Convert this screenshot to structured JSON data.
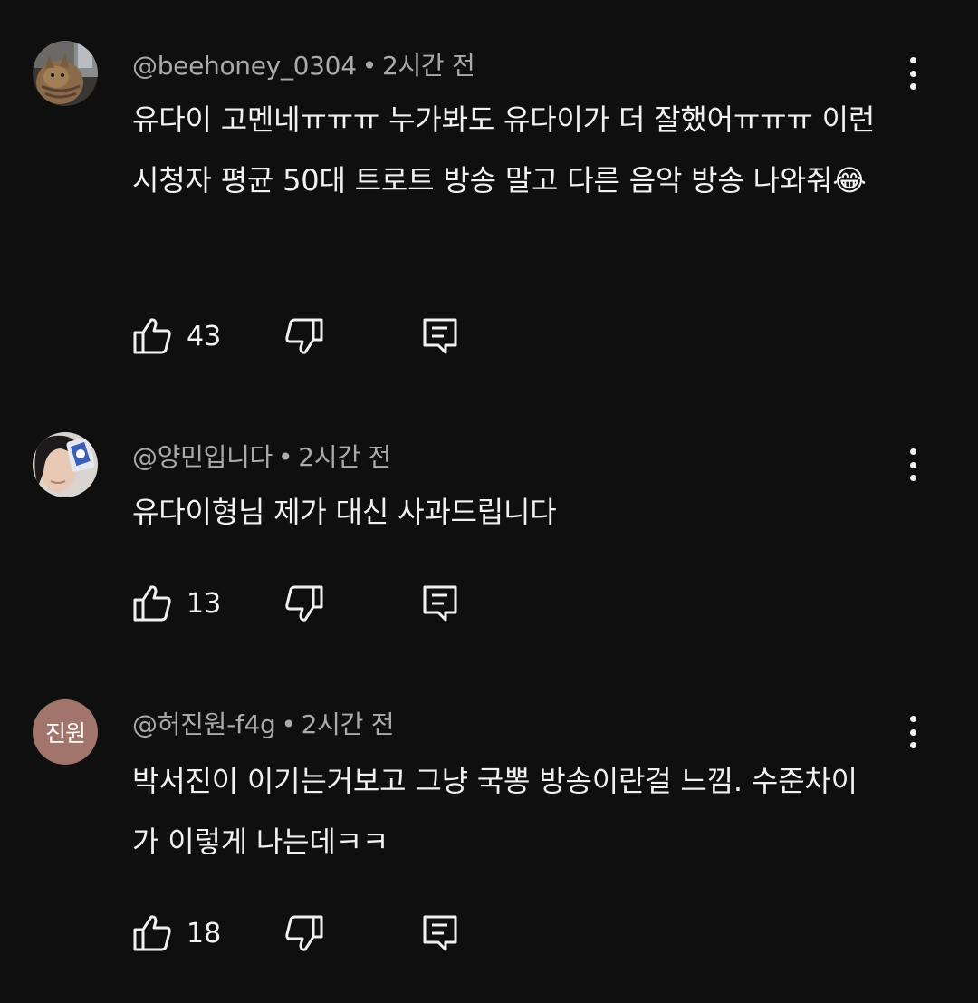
{
  "comments": [
    {
      "author": "@beehoney_0304",
      "separator": "•",
      "time": "2시간 전",
      "text": "유다이 고멘네ㅠㅠㅠ 누가봐도 유다이가 더 잘했어ㅠㅠㅠ 이런 시청자 평균 50대 트로트 방송 말고 다른 음악 방송 나와줘😂",
      "likes": "43",
      "avatar_type": "photo-cat"
    },
    {
      "author": "@양민입니다",
      "separator": "•",
      "time": "2시간 전",
      "text": "유다이형님 제가 대신 사과드립니다",
      "likes": "13",
      "avatar_type": "photo-person"
    },
    {
      "author": "@허진원-f4g",
      "separator": "•",
      "time": "2시간 전",
      "text": "박서진이 이기는거보고 그냥 국뽕 방송이란걸 느낌. 수준차이가 이렇게 나는데ㅋㅋ",
      "likes": "18",
      "avatar_type": "initials",
      "avatar_initials": "진원"
    }
  ],
  "icons": {
    "like": "thumbs-up-icon",
    "dislike": "thumbs-down-icon",
    "reply": "reply-comment-icon",
    "more": "more-vertical-icon"
  },
  "colors": {
    "background": "#0f0f0f",
    "text": "#f1f1f1",
    "meta": "#aaaaaa",
    "initials_avatar": "#a1756c"
  }
}
